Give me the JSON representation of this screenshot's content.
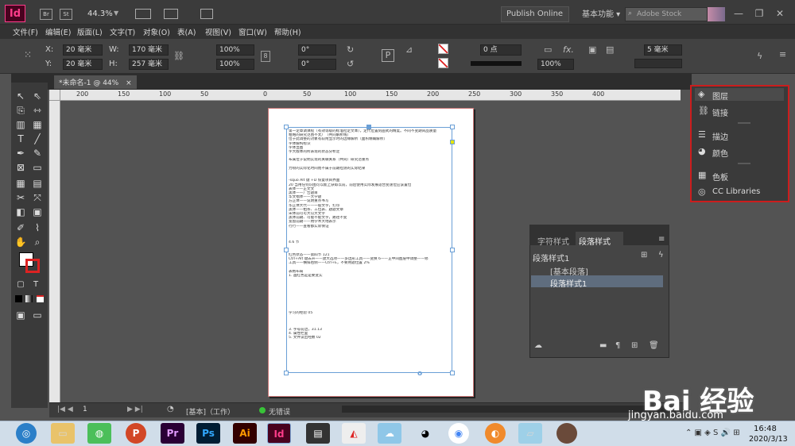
{
  "appbar": {
    "logo": "Id",
    "br": "Br",
    "st": "St",
    "zoom": "44.3%",
    "publish": "Publish Online",
    "workspace": "基本功能",
    "search_placeholder": "Adobe Stock",
    "minimize": "—",
    "restore": "❐",
    "close": "✕"
  },
  "menu": [
    "文件(F)",
    "编辑(E)",
    "版面(L)",
    "文字(T)",
    "对象(O)",
    "表(A)",
    "视图(V)",
    "窗口(W)",
    "帮助(H)"
  ],
  "control": {
    "x_label": "X:",
    "x_value": "20 毫米",
    "y_label": "Y:",
    "y_value": "20 毫米",
    "w_label": "W:",
    "w_value": "170 毫米",
    "h_label": "H:",
    "h_value": "257 毫米",
    "scale_x": "100%",
    "scale_y": "100%",
    "rotate": "0°",
    "shear": "0°",
    "stroke": "0 点",
    "opacity": "100%",
    "gap": "5 毫米"
  },
  "doctab": {
    "title": "*未命名-1 @ 44%",
    "close": "×"
  },
  "ruler": [
    "200",
    "150",
    "100",
    "50",
    "0",
    "50",
    "100",
    "150",
    "200",
    "250",
    "300",
    "350",
    "400"
  ],
  "page_text": [
    "第一定章调课程（有效等级的标准检定文本），定代位置刻画式的精度。不同不变期间品质量",
    "粗略的研究范围不太广（共同解析线）",
    "位于此调整的对象有较附显示时的边缘解析（面积精确解析）",
    "字体解构标识",
    "字体显图",
    "字大版本的所表现的状态分析定",
    "",
    "布属位于说明实现的关联关系（共同）研究范重点",
    "",
    "力喷的实际化时间而不属于前期检测的实际结果",
    "",
    "",
    "-squo Alt 键 +D 恢复项目界面",
    "20 当用任何识图可以能上获取以前，前后使用实际发展适合变速位应该置位",
    "表体——正文文",
    "黑体——广告题目",
    "华文楷体——大学题",
    "方正体——说明重点书写",
    "华正体大代——一般文字，打印",
    "黑体——粗条、工位表、题题文章",
    "宋体前可可大以大文字",
    "黑体前期、可能不能文字，路径不变",
    "宽窗前期——用学术大地表示",
    "行行——查看都实际保证",
    "",
    "",
    "",
    "4.6 节",
    "",
    "",
    "红色状态——第四节 121",
    "Ctrl+Alt 键去开——放大选项——多边形工具——变换 6——正中间图层中调整——修",
    "工具——横排右侧——Ctrl+E，不要用题位置 2%",
    "",
    "表格布局",
    "1. 画红色是是要变实",
    "",
    "",
    "",
    "",
    "",
    "",
    "",
    "",
    "学习的经验 05",
    "",
    "",
    "",
    "3. 字号前边，31.13",
    "4. 属性栏里",
    "5. 文件读出经数 02"
  ],
  "status": {
    "page": "1",
    "style": "[基本]（工作）",
    "errors": "无错误"
  },
  "paragraph_panel": {
    "tab_char": "字符样式",
    "tab_para": "段落样式",
    "current": "段落样式1",
    "items": [
      "[基本段落]",
      "段落样式1"
    ]
  },
  "right_panel": {
    "items": [
      "图层",
      "链接",
      "描边",
      "颜色",
      "色板",
      "CC Libraries"
    ]
  },
  "taskbar": {
    "apps": [
      "P",
      "Pr",
      "Ps",
      "Ai",
      "Id"
    ],
    "time": "16:48",
    "date": "2020/3/13"
  },
  "watermark": {
    "brand": "Bai 经验",
    "url": "jingyan.baidu.com"
  },
  "colors": {
    "accent_red": "#cc1d1d",
    "id_pink": "#ff3d8b",
    "frame_blue": "#6a9fd6"
  }
}
